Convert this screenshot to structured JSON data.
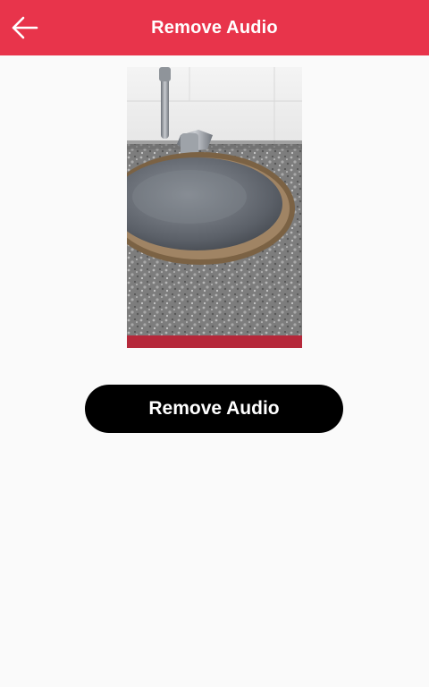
{
  "header": {
    "title": "Remove Audio",
    "back_icon": "back-arrow-icon",
    "background_color": "#e8344b"
  },
  "main": {
    "preview_description": "Video frame: stainless sink in granite countertop",
    "action_button_label": "Remove Audio",
    "action_button_color": "#000000"
  }
}
